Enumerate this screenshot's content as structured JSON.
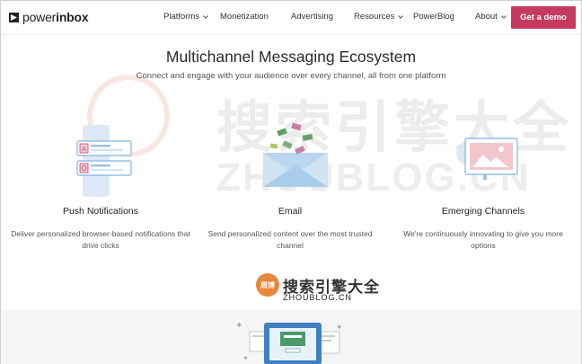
{
  "brand": {
    "name_light": "power",
    "name_bold": "inbox"
  },
  "nav": {
    "items": [
      {
        "label": "Platforms",
        "has_dropdown": true
      },
      {
        "label": "Monetization",
        "has_dropdown": false
      },
      {
        "label": "Advertising",
        "has_dropdown": false
      },
      {
        "label": "Resources",
        "has_dropdown": true
      },
      {
        "label": "PowerBlog",
        "has_dropdown": false
      },
      {
        "label": "About",
        "has_dropdown": true
      }
    ],
    "cta_label": "Get a demo"
  },
  "hero": {
    "title": "Multichannel Messaging Ecosystem",
    "subtitle": "Connect and engage with your audience over every channel, all from one platform"
  },
  "features": [
    {
      "title": "Push Notifications",
      "description": "Deliver personalized browser-based notifications that drive clicks",
      "icon": "push-notification-icon"
    },
    {
      "title": "Email",
      "description": "Send personalized content over the most trusted channel",
      "icon": "email-envelope-icon"
    },
    {
      "title": "Emerging Channels",
      "description": "We're continuously innovating to give you more options",
      "icon": "emerging-channels-icon"
    }
  ],
  "watermark": {
    "cn": "搜索引擎大全",
    "en": "ZHOUBLOG.CN",
    "badge": "周博"
  },
  "colors": {
    "accent": "#c53a5e",
    "icon_blue": "#7fb5de",
    "icon_light_blue": "#cfe3f4",
    "lower_bg": "#f5f5f5"
  }
}
